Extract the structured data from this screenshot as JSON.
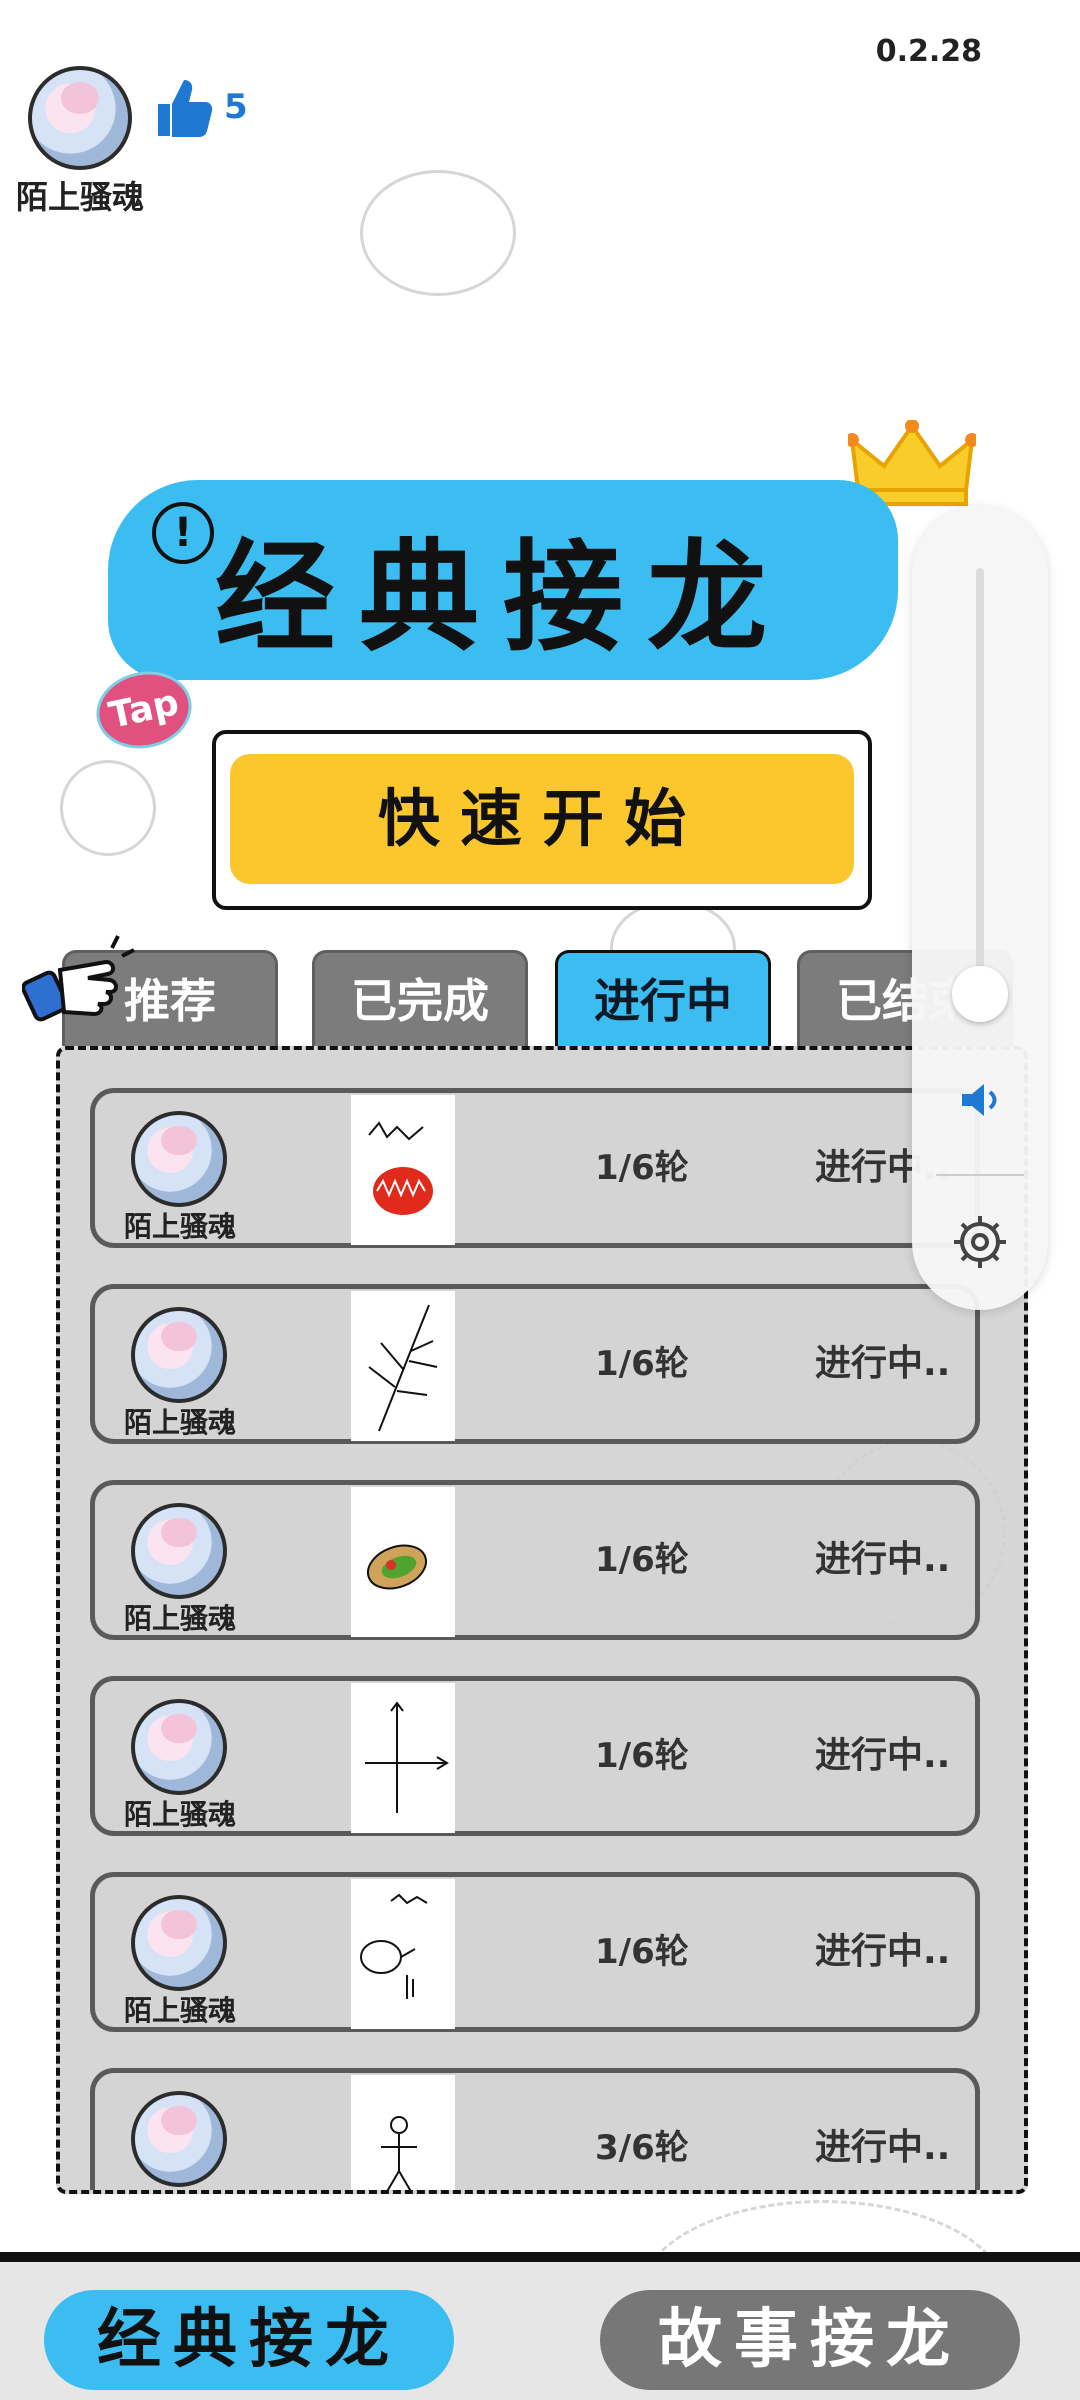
{
  "version": "0.2.28",
  "profile": {
    "name": "陌上骚魂",
    "likes": "5"
  },
  "title": "经典接龙",
  "quick_start": "快速开始",
  "tap_badge": "Tap",
  "tabs": [
    {
      "label": "推荐",
      "active": false
    },
    {
      "label": "已完成",
      "active": false
    },
    {
      "label": "进行中",
      "active": true
    },
    {
      "label": "已结束",
      "active": false
    }
  ],
  "games": [
    {
      "player": "陌上骚魂",
      "round": "1/6轮",
      "status": "进行中.."
    },
    {
      "player": "陌上骚魂",
      "round": "1/6轮",
      "status": "进行中.."
    },
    {
      "player": "陌上骚魂",
      "round": "1/6轮",
      "status": "进行中.."
    },
    {
      "player": "陌上骚魂",
      "round": "1/6轮",
      "status": "进行中.."
    },
    {
      "player": "陌上骚魂",
      "round": "1/6轮",
      "status": "进行中.."
    },
    {
      "player": "",
      "round": "3/6轮",
      "status": "进行中.."
    }
  ],
  "bottom_nav": [
    {
      "label": "经典接龙",
      "active": true
    },
    {
      "label": "故事接龙",
      "active": false
    }
  ],
  "volume": {
    "level": 0.07
  },
  "colors": {
    "accent_blue": "#3cbdf1",
    "accent_yellow": "#fbc72d",
    "tab_gray": "#7c7c7c",
    "like_blue": "#1f78d1"
  }
}
